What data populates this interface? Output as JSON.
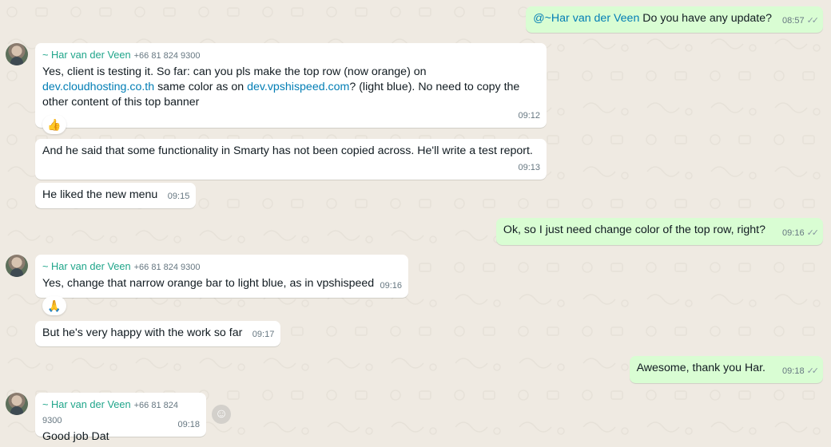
{
  "contact": {
    "name": "~ Har van der Veen",
    "phone": "+66 81 824 9300"
  },
  "colors": {
    "outgoing_bubble": "#d9fdd3",
    "incoming_bubble": "#ffffff",
    "sender_name": "#1fa58a",
    "link": "#027eb5",
    "background": "#efeae2"
  },
  "messages": {
    "m1": {
      "mention": "@~Har van der Veen",
      "text": " Do you have any update?",
      "time": "08:57",
      "status_icon": "double-check-icon"
    },
    "m2": {
      "text_a": "Yes, client is testing it. So far: can you pls make the top row (now orange) on ",
      "link_a": "dev.cloudhosting.co.th",
      "text_b": " same color as on ",
      "link_b": "dev.vpshispeed.com",
      "text_c": "? (light blue). No need to copy the other content of this top banner",
      "time": "09:12",
      "reaction": "👍"
    },
    "m3": {
      "text": "And he said that some functionality in Smarty has not been copied across. He'll write a test report.",
      "time": "09:13"
    },
    "m4": {
      "text": "He liked the new menu",
      "time": "09:15"
    },
    "m5": {
      "text": "Ok, so I just need change color of the top row, right?",
      "time": "09:16",
      "status_icon": "double-check-icon"
    },
    "m6": {
      "text": "Yes, change that narrow orange bar to light blue, as in vpshispeed",
      "time": "09:16",
      "reaction": "🙏"
    },
    "m7": {
      "text": "But he's very happy with the work so far",
      "time": "09:17"
    },
    "m8": {
      "text": "Awesome, thank you Har.",
      "time": "09:18",
      "status_icon": "double-check-icon"
    },
    "m9": {
      "text": "Good job Dat",
      "time": "09:18"
    }
  },
  "emoji_reaction_button": {
    "icon": "smiley-icon",
    "glyph": "☺"
  },
  "ticks_glyph": "✓✓"
}
